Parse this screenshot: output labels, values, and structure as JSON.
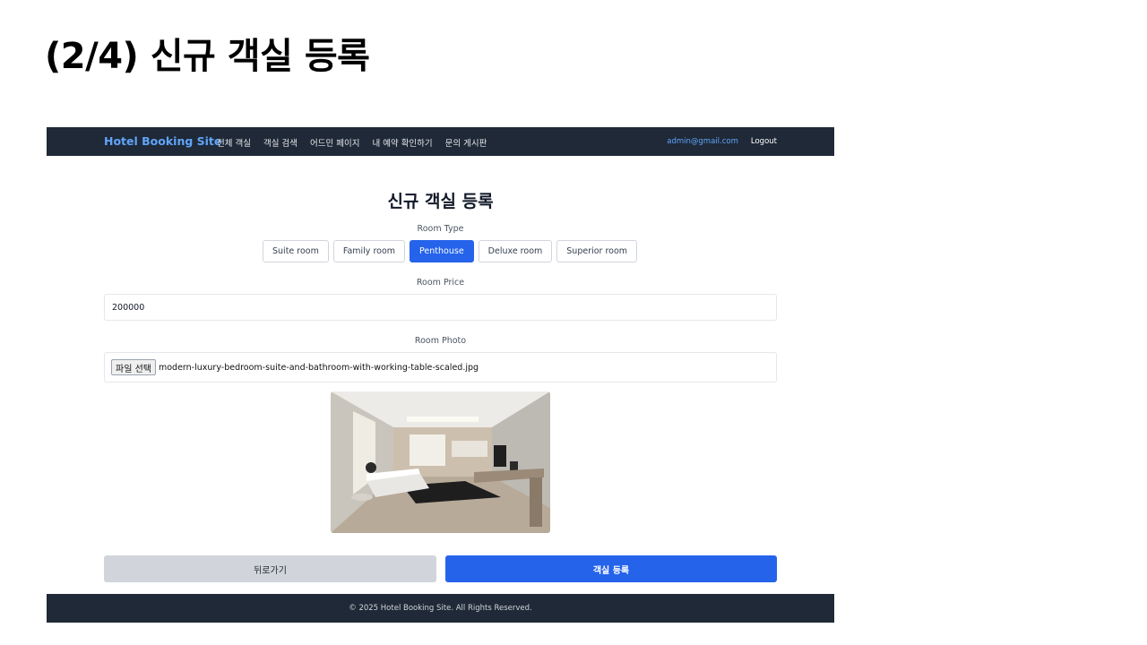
{
  "slide": {
    "title": "(2/4) 신규 객실 등록"
  },
  "navbar": {
    "brand": "Hotel Booking Site",
    "links": [
      "전체 객실",
      "객실 검색",
      "어드민 페이지",
      "내 예약 확인하기",
      "문의 게시판"
    ],
    "user_email": "admin@gmail.com",
    "logout": "Logout"
  },
  "form": {
    "heading": "신규 객실 등록",
    "room_type": {
      "label": "Room Type",
      "options": [
        "Suite room",
        "Family room",
        "Penthouse",
        "Deluxe room",
        "Superior room"
      ],
      "selected": "Penthouse"
    },
    "room_price": {
      "label": "Room Price",
      "value": "200000"
    },
    "room_photo": {
      "label": "Room Photo",
      "choose_button": "파일 선택",
      "file_name": "modern-luxury-bedroom-suite-and-bathroom-with-working-table-scaled.jpg"
    },
    "back_button": "뒤로가기",
    "submit_button": "객실 등록"
  },
  "footer": {
    "text": "© 2025 Hotel Booking Site. All Rights Reserved."
  },
  "colors": {
    "navbar_bg": "#1f2937",
    "brand": "#60a5fa",
    "primary": "#2563eb",
    "secondary_button": "#d1d5db"
  }
}
